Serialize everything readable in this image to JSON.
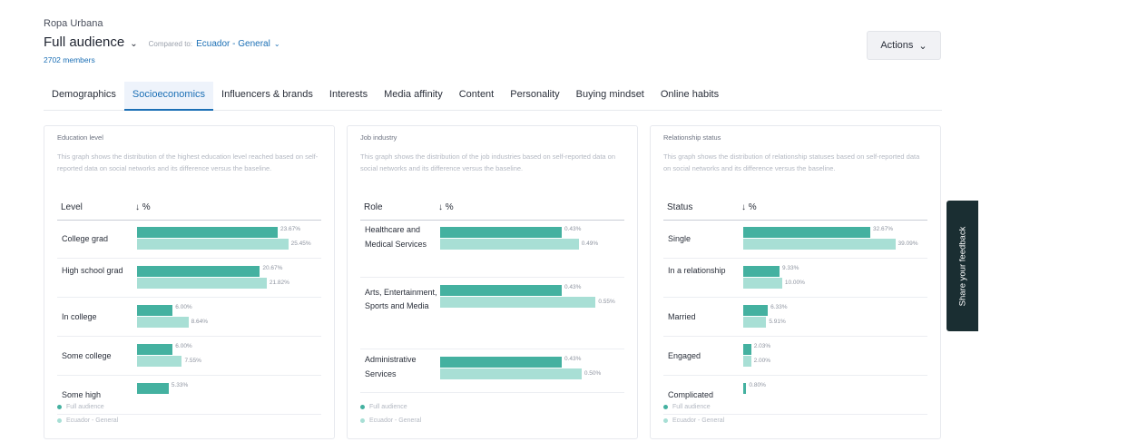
{
  "header": {
    "brand": "Ropa Urbana",
    "audience": "Full audience",
    "compared_label": "Compared to:",
    "compared_value": "Ecuador - General",
    "members": "2702 members",
    "actions": "Actions"
  },
  "tabs": [
    {
      "label": "Demographics",
      "active": false
    },
    {
      "label": "Socioeconomics",
      "active": true
    },
    {
      "label": "Influencers & brands",
      "active": false
    },
    {
      "label": "Interests",
      "active": false
    },
    {
      "label": "Media affinity",
      "active": false
    },
    {
      "label": "Content",
      "active": false
    },
    {
      "label": "Personality",
      "active": false
    },
    {
      "label": "Buying mindset",
      "active": false
    },
    {
      "label": "Online habits",
      "active": false
    }
  ],
  "colors": {
    "full": "#44b1a0",
    "baseline": "#a8dfd5",
    "accent": "#1b6fb5"
  },
  "legend": {
    "full": "Full audience",
    "baseline": "Ecuador - General"
  },
  "feedback": "Share your feedback",
  "cards": [
    {
      "title": "Education level",
      "description": "This graph shows the distribution of the highest education level reached based on self-reported data on social networks and its difference versus the baseline.",
      "col_label": "Level",
      "col_pct": "↓ %",
      "rows": [
        {
          "label": "College grad",
          "full": 23.67,
          "full_label": "23.67%",
          "base": 25.45,
          "base_label": "25.45%"
        },
        {
          "label": "High school grad",
          "full": 20.67,
          "full_label": "20.67%",
          "base": 21.82,
          "base_label": "21.82%"
        },
        {
          "label": "In college",
          "full": 6.0,
          "full_label": "6.00%",
          "base": 8.64,
          "base_label": "8.64%"
        },
        {
          "label": "Some college",
          "full": 6.0,
          "full_label": "6.00%",
          "base": 7.55,
          "base_label": "7.55%"
        },
        {
          "label": "Some high",
          "full": 5.33,
          "full_label": "5.33%",
          "base": null,
          "base_label": ""
        }
      ]
    },
    {
      "title": "Job industry",
      "description": "This graph shows the distribution of the job industries based on self-reported data on social networks and its difference versus the baseline.",
      "col_label": "Role",
      "col_pct": "↓ %",
      "rows": [
        {
          "label": "Healthcare and Medical Services",
          "full": 0.43,
          "full_label": "0.43%",
          "base": 0.49,
          "base_label": "0.49%"
        },
        {
          "label": "Arts, Entertainment, Sports and Media",
          "full": 0.43,
          "full_label": "0.43%",
          "base": 0.55,
          "base_label": "0.55%"
        },
        {
          "label": "Administrative Services",
          "full": 0.43,
          "full_label": "0.43%",
          "base": 0.5,
          "base_label": "0.50%"
        }
      ]
    },
    {
      "title": "Relationship status",
      "description": "This graph shows the distribution of relationship statuses based on self-reported data on social networks and its difference versus the baseline.",
      "col_label": "Status",
      "col_pct": "↓ %",
      "rows": [
        {
          "label": "Single",
          "full": 32.67,
          "full_label": "32.67%",
          "base": 39.09,
          "base_label": "39.09%"
        },
        {
          "label": "In a relationship",
          "full": 9.33,
          "full_label": "9.33%",
          "base": 10.0,
          "base_label": "10.00%"
        },
        {
          "label": "Married",
          "full": 6.33,
          "full_label": "6.33%",
          "base": 5.91,
          "base_label": "5.91%"
        },
        {
          "label": "Engaged",
          "full": 2.03,
          "full_label": "2.03%",
          "base": 2.0,
          "base_label": "2.00%"
        },
        {
          "label": "Complicated",
          "full": 0.8,
          "full_label": "0.80%",
          "base": null,
          "base_label": ""
        }
      ]
    }
  ]
}
